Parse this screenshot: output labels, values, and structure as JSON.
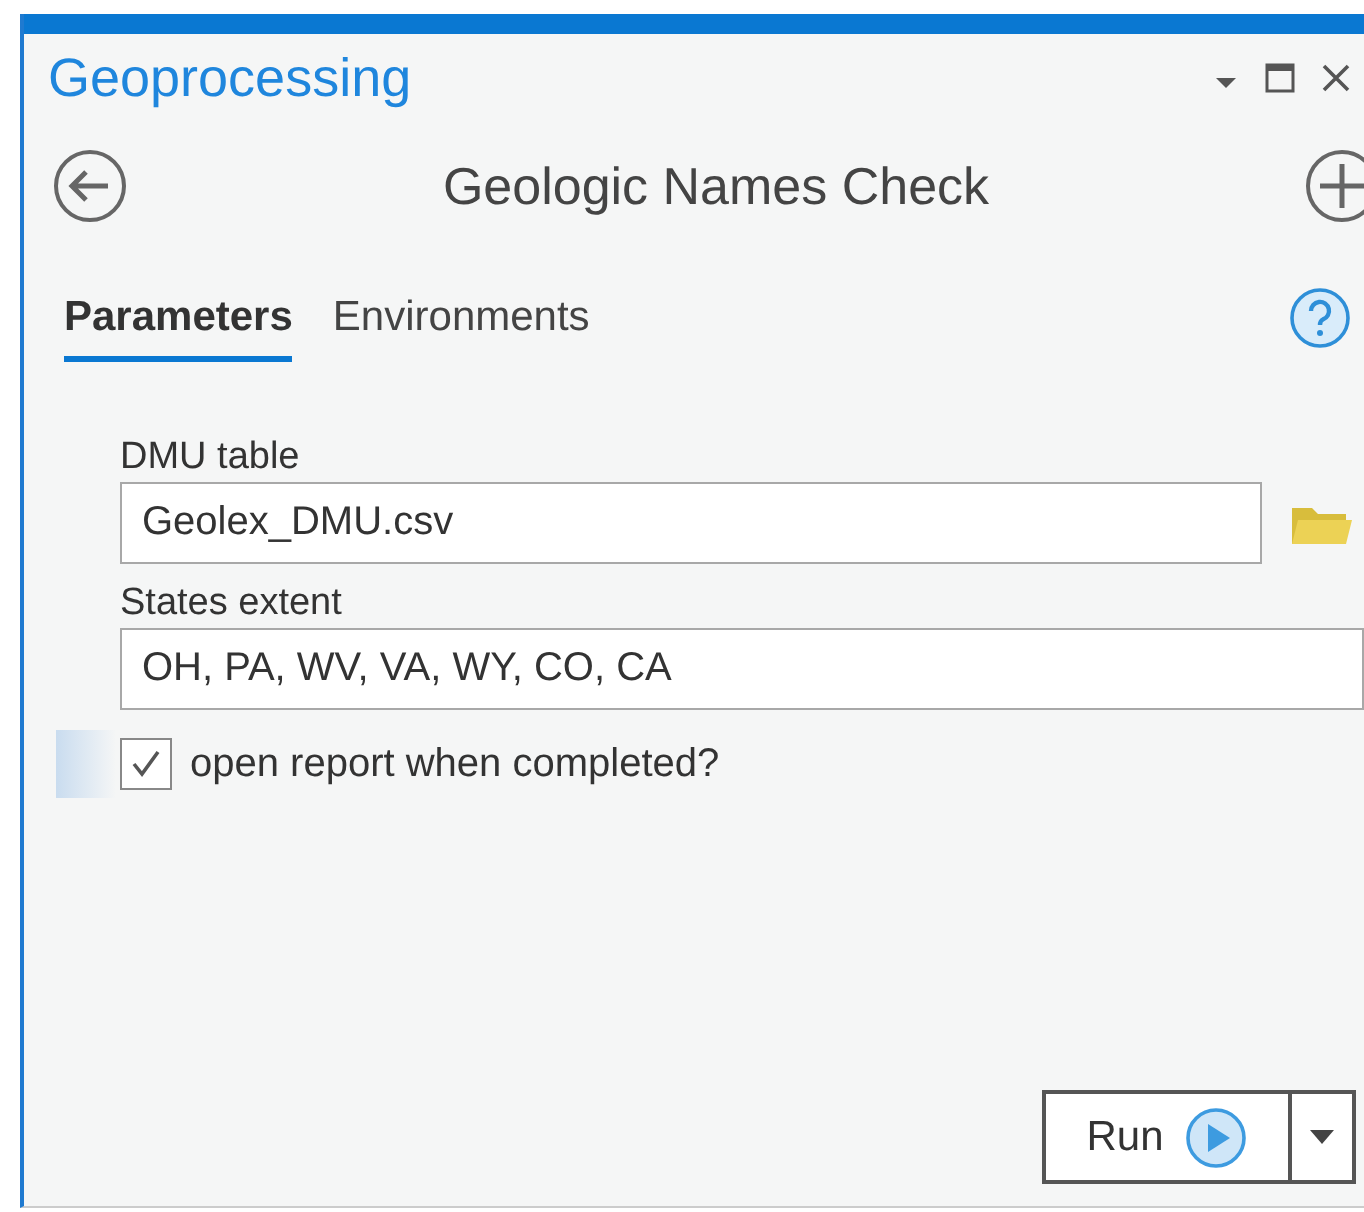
{
  "pane": {
    "title": "Geoprocessing"
  },
  "tool": {
    "title": "Geologic Names Check"
  },
  "tabs": [
    {
      "label": "Parameters",
      "selected": true
    },
    {
      "label": "Environments",
      "selected": false
    }
  ],
  "parameters": [
    {
      "kind": "file",
      "label": "DMU table",
      "value": "Geolex_DMU.csv"
    },
    {
      "kind": "text",
      "label": "States extent",
      "value": "OH, PA, WV, VA, WY, CO, CA"
    },
    {
      "kind": "checkbox",
      "label": "open report when completed?",
      "checked": true
    }
  ],
  "run_button": {
    "label": "Run"
  }
}
